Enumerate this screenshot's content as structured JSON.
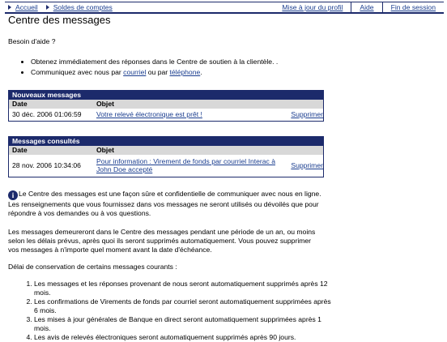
{
  "nav": {
    "home": "Accueil",
    "balances": "Soldes de comptes",
    "profile": "Mise à jour du profil",
    "help": "Aide",
    "logout": "Fin de session"
  },
  "page_title": "Centre des messages",
  "help_heading": "Besoin d'aide ?",
  "bullets": {
    "b1": "Obtenez immédiatement des réponses dans le Centre de soutien à la clientèle. .",
    "b2_pre": "Communiquez avec nous par ",
    "b2_link1": "courriel",
    "b2_mid": " ou par ",
    "b2_link2": "téléphone",
    "b2_post": "."
  },
  "new_messages": {
    "title": "Nouveaux messages",
    "col_date": "Date",
    "col_subject": "Objet",
    "rows": [
      {
        "date": "30 déc. 2006 01:06:59",
        "subject": "Votre relevé électronique est prêt !",
        "action": "Supprimer"
      }
    ]
  },
  "read_messages": {
    "title": "Messages consultés",
    "col_date": "Date",
    "col_subject": "Objet",
    "rows": [
      {
        "date": "28 nov. 2006 10:34:06",
        "subject": "Pour information : Virement de fonds par courriel Interac à John Doe accepté",
        "action": "Supprimer"
      }
    ]
  },
  "info": {
    "p1": "Le Centre des messages est une façon sûre et confidentielle de communiquer avec nous en ligne. Les renseignements que vous fournissez dans vos messages ne seront utilisés ou dévoilés que pour répondre à vos demandes ou à vos questions.",
    "p2": "Les messages demeureront dans le Centre des messages pendant une période de un an, ou moins selon les délais prévus, après quoi ils seront supprimés automatiquement. Vous pouvez supprimer vos messages à n'importe quel moment avant la date d'échéance.",
    "p3": "Délai de conservation de certains messages courants :",
    "list": [
      "Les messages et les réponses provenant de nous seront automatiquement supprimés après 12 mois.",
      "Les confirmations de Virements de fonds par courriel seront automatiquement supprimées après 6 mois.",
      "Les mises à jour générales de Banque en direct seront automatiquement supprimées après 1 mois.",
      "Les avis de relevés électroniques seront automatiquement supprimés après 90 jours."
    ]
  },
  "colors": {
    "navy": "#1c2a6b",
    "link": "#1a3d8f",
    "header_gray": "#d8d8d8"
  }
}
